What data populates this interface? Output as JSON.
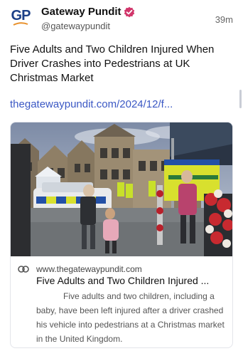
{
  "author": {
    "avatar_text": "GP",
    "name": "Gateway Pundit",
    "handle": "@gatewaypundit",
    "time": "39m"
  },
  "post": {
    "text": "Five Adults and Two Children Injured When Driver Crashes into Pedestrians at UK Christmas Market",
    "link": "thegatewaypundit.com/2024/12/f..."
  },
  "card": {
    "image_icon": "christmas-market-photo",
    "domain": "www.thegatewaypundit.com",
    "title": "Five Adults and Two Children Injured ...",
    "description": "Five adults and two children, including a baby, have been left injured after a driver crashed his vehicle into pedestrians at a Christmas market in the United Kingdom."
  },
  "colors": {
    "link": "#3b58c4",
    "brand_navy": "#1b3f87",
    "brand_orange": "#e8902a",
    "verified": "#d1356a"
  }
}
